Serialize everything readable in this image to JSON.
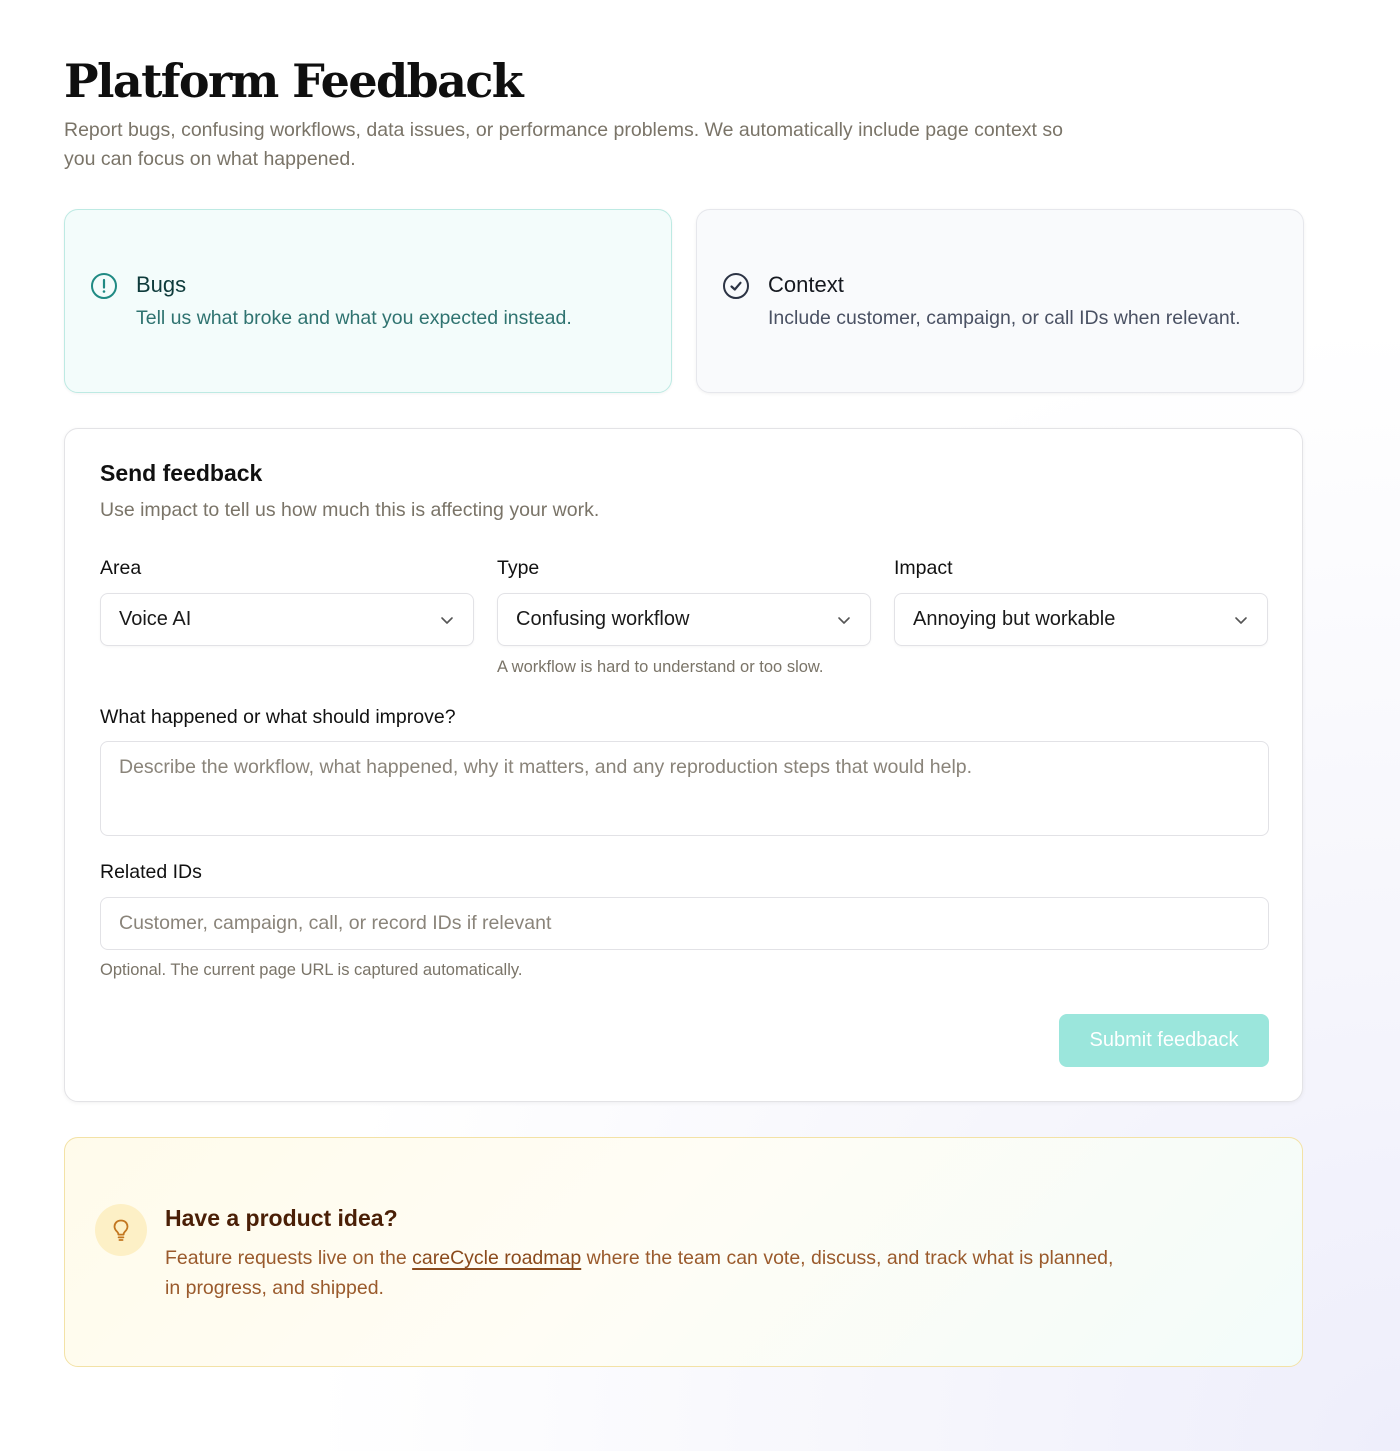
{
  "header": {
    "title": "Platform Feedback",
    "subtitle": "Report bugs, confusing workflows, data issues, or performance problems. We automatically include page context so you can focus on what happened."
  },
  "info_cards": {
    "bugs": {
      "title": "Bugs",
      "description": "Tell us what broke and what you expected instead.",
      "icon": "alert-circle-icon",
      "accent": "#1f8a83"
    },
    "context": {
      "title": "Context",
      "description": "Include customer, campaign, or call IDs when relevant.",
      "icon": "check-circle-icon",
      "accent": "#2c3344"
    }
  },
  "form": {
    "title": "Send feedback",
    "subtitle": "Use impact to tell us how much this is affecting your work.",
    "area": {
      "label": "Area",
      "value": "Voice AI"
    },
    "type": {
      "label": "Type",
      "value": "Confusing workflow",
      "helper": "A workflow is hard to understand or too slow."
    },
    "impact": {
      "label": "Impact",
      "value": "Annoying but workable"
    },
    "description": {
      "label": "What happened or what should improve?",
      "placeholder": "Describe the workflow, what happened, why it matters, and any reproduction steps that would help."
    },
    "related_ids": {
      "label": "Related IDs",
      "placeholder": "Customer, campaign, call, or record IDs if relevant",
      "helper": "Optional. The current page URL is captured automatically."
    },
    "submit_label": "Submit feedback"
  },
  "idea": {
    "title": "Have a product idea?",
    "desc_before": "Feature requests live on the ",
    "link_text": "careCycle roadmap",
    "desc_after": " where the team can vote, discuss, and track what is planned, in progress, and shipped.",
    "icon": "lightbulb-icon"
  },
  "colors": {
    "submit_disabled": "#9be6dc",
    "bugs_bg": "#f3fcfb",
    "idea_text": "#9a5a2c"
  }
}
